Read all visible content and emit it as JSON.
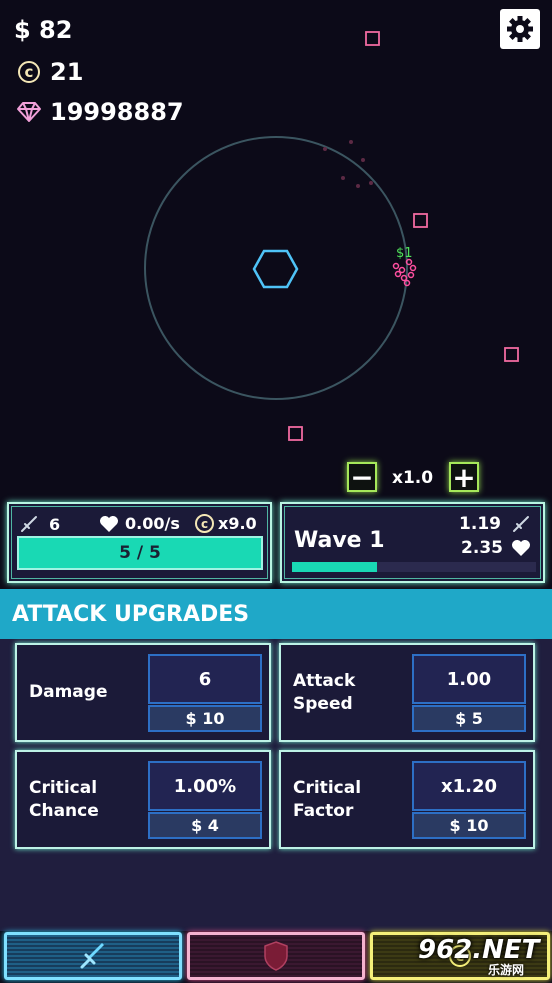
{
  "resources": {
    "money": "$ 82",
    "coins": "21",
    "gems": "19998887"
  },
  "game_speed": {
    "minus_label": "−",
    "plus_label": "+",
    "value": "x1.0"
  },
  "floating_reward": "$1",
  "tower_panel": {
    "damage": "6",
    "regen": "0.00/s",
    "coin_multiplier": "x9.0",
    "health": "5 / 5",
    "health_fraction": 1.0
  },
  "wave_panel": {
    "title": "Wave 1",
    "enemy_damage": "1.19",
    "enemy_health": "2.35",
    "progress_fraction": 0.35
  },
  "section_title": "ATTACK UPGRADES",
  "upgrades": [
    {
      "label_line1": "Damage",
      "label_line2": "",
      "value": "6",
      "cost": "$ 10"
    },
    {
      "label_line1": "Attack",
      "label_line2": "Speed",
      "value": "1.00",
      "cost": "$ 5"
    },
    {
      "label_line1": "Critical",
      "label_line2": "Chance",
      "value": "1.00%",
      "cost": "$ 4"
    },
    {
      "label_line1": "Critical",
      "label_line2": "Factor",
      "value": "x1.20",
      "cost": "$ 10"
    }
  ],
  "tabs": [
    {
      "name": "attack",
      "icon": "sword-icon",
      "color": "#33c7f0"
    },
    {
      "name": "defense",
      "icon": "shield-icon",
      "color": "#e0508a"
    },
    {
      "name": "utility",
      "icon": "coin-icon",
      "color": "#e8e04a"
    }
  ],
  "watermark": {
    "main": "962.NET",
    "sub": "乐游网"
  },
  "colors": {
    "background": "#0c0a18",
    "accent_teal": "#19d9b4",
    "section_header": "#1fa8c8",
    "enemy_pink": "#f06aa0",
    "tower_blue": "#4fc3f7",
    "speed_green": "#a6e85a"
  }
}
